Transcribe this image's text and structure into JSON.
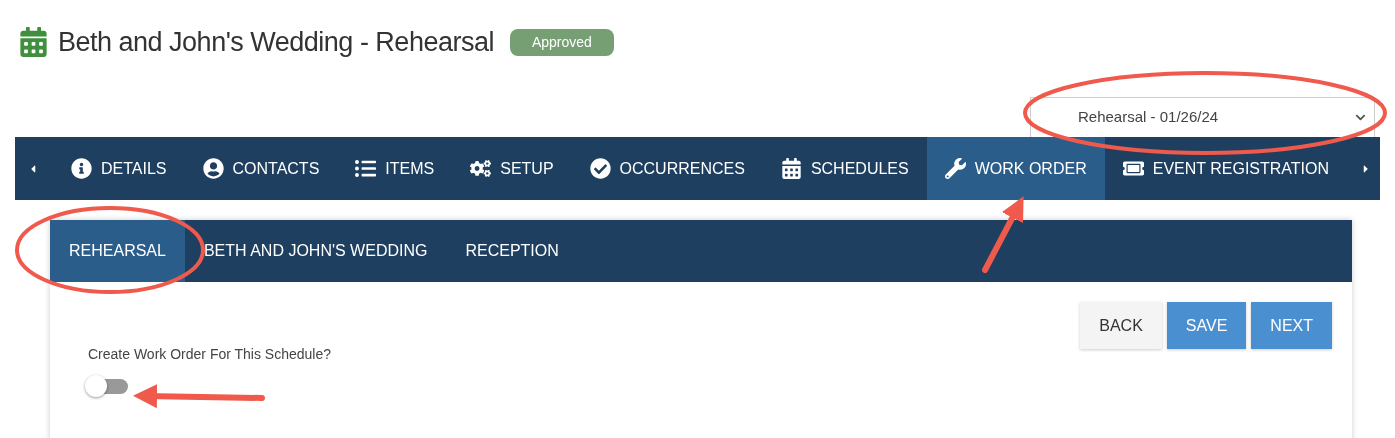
{
  "header": {
    "title": "Beth and John's Wedding - Rehearsal",
    "status": "Approved"
  },
  "schedule_select": {
    "value": "Rehearsal - 01/26/24"
  },
  "nav_tabs": [
    {
      "label": "DETAILS",
      "selected": false
    },
    {
      "label": "CONTACTS",
      "selected": false
    },
    {
      "label": "ITEMS",
      "selected": false
    },
    {
      "label": "SETUP",
      "selected": false
    },
    {
      "label": "OCCURRENCES",
      "selected": false
    },
    {
      "label": "SCHEDULES",
      "selected": false
    },
    {
      "label": "WORK ORDER",
      "selected": true
    },
    {
      "label": "EVENT REGISTRATION",
      "selected": false
    }
  ],
  "schedule_tabs": [
    {
      "label": "REHEARSAL",
      "selected": true
    },
    {
      "label": "BETH AND JOHN'S WEDDING",
      "selected": false
    },
    {
      "label": "RECEPTION",
      "selected": false
    }
  ],
  "buttons": [
    {
      "label": "BACK",
      "kind": "secondary"
    },
    {
      "label": "SAVE",
      "kind": "primary"
    },
    {
      "label": "NEXT",
      "kind": "primary"
    }
  ],
  "work_order_toggle": {
    "label": "Create Work Order For This Schedule?",
    "on": false
  }
}
